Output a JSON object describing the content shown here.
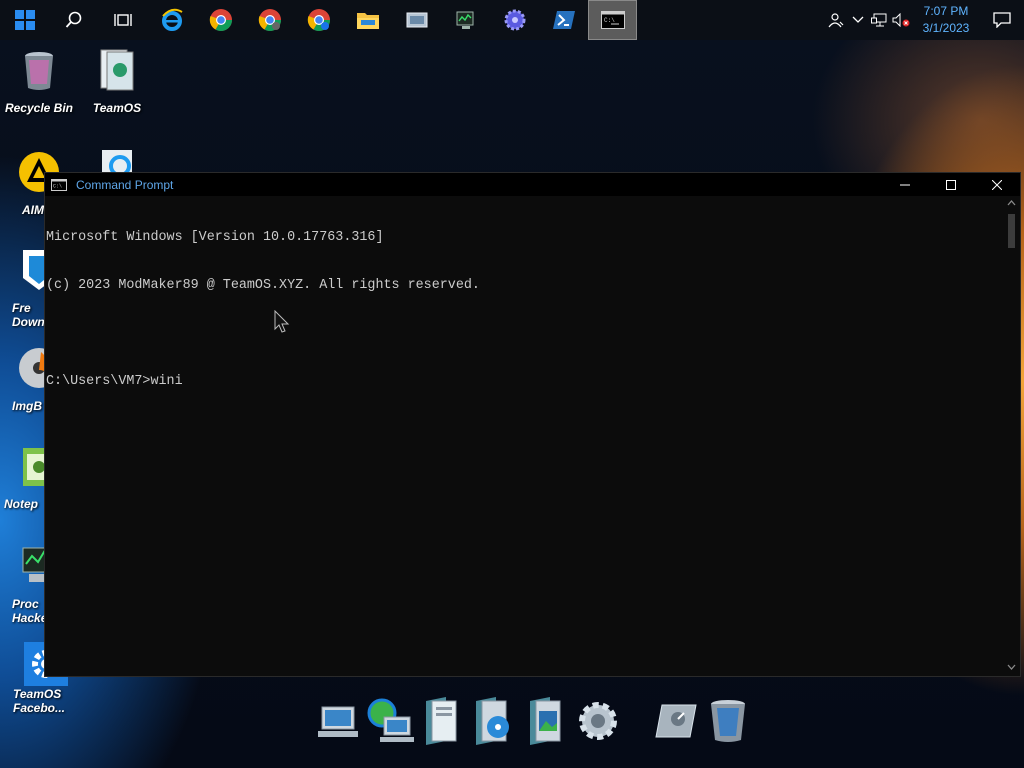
{
  "taskbar": {
    "apps": [
      {
        "name": "start-icon"
      },
      {
        "name": "search-icon"
      },
      {
        "name": "task-view-icon"
      },
      {
        "name": "internet-explorer-icon"
      },
      {
        "name": "chrome-icon"
      },
      {
        "name": "chrome-icon-2"
      },
      {
        "name": "chrome-icon-3"
      },
      {
        "name": "file-explorer-icon"
      },
      {
        "name": "control-panel-icon"
      },
      {
        "name": "system-monitor-icon"
      },
      {
        "name": "settings-gear-icon"
      },
      {
        "name": "powershell-icon"
      },
      {
        "name": "command-prompt-icon"
      }
    ],
    "clock": {
      "time": "7:07 PM",
      "date": "3/1/2023"
    }
  },
  "desktop_icons": [
    {
      "label": "Recycle Bin",
      "icon": "recycle-bin-icon"
    },
    {
      "label": "TeamOS",
      "icon": "teamos-icon"
    },
    {
      "label": "AIM",
      "icon": "aim-icon"
    },
    {
      "label": "",
      "icon": "internet-explorer-icon"
    },
    {
      "label": "Fre\nDown",
      "icon": "free-download-icon"
    },
    {
      "label": "ImgB",
      "icon": "imgburn-icon"
    },
    {
      "label": "Notep",
      "icon": "notepad-icon"
    },
    {
      "label": "Proc\nHacke",
      "icon": "process-hacker-icon"
    },
    {
      "label": "TeamOS\nFacebo...",
      "icon": "teamos-facebook-icon"
    }
  ],
  "cmd": {
    "title": "Command Prompt",
    "lines": [
      "Microsoft Windows [Version 10.0.17763.316]",
      "(c) 2023 ModMaker89 @ TeamOS.XYZ. All rights reserved.",
      "",
      "C:\\Users\\VM7>wini"
    ],
    "buttons": {
      "minimize": "—",
      "maximize": "☐",
      "close": "✕"
    }
  },
  "dock": [
    "computer-icon",
    "network-icon",
    "documents-icon",
    "media-icon",
    "pictures-icon",
    "settings-icon",
    "control-panel-icon",
    "recycle-bin-icon"
  ],
  "colors": {
    "accent": "#5fb4ff",
    "terminal_bg": "#0c0c0c",
    "terminal_text": "#cccccc"
  }
}
